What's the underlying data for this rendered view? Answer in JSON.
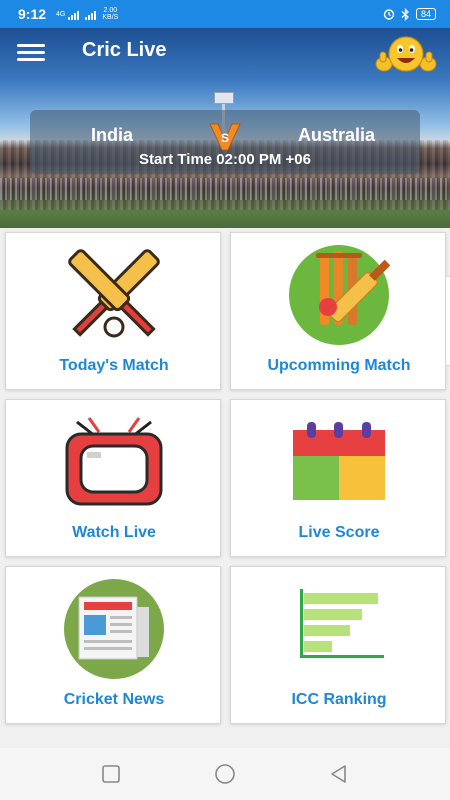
{
  "status_bar": {
    "time": "9:12",
    "network_type": "4G",
    "data_speed_value": "2.00",
    "data_speed_unit": "KB/S",
    "battery": "84"
  },
  "header": {
    "title": "Cric Live",
    "menu_icon": "hamburger-menu-icon",
    "emoji_icon": "thumbs-up-smiley-icon"
  },
  "match": {
    "team_a": "India",
    "team_b": "Australia",
    "vs_icon": "vs-icon",
    "start_time": "Start Time 02:00 PM +06"
  },
  "menu": [
    {
      "label": "Today's Match",
      "icon": "crossed-bats-ball-icon"
    },
    {
      "label": "Upcomming Match",
      "icon": "bat-stumps-ball-icon"
    },
    {
      "label": "Watch Live",
      "icon": "retro-tv-icon"
    },
    {
      "label": "Live Score",
      "icon": "calendar-icon"
    },
    {
      "label": "Cricket News",
      "icon": "newspaper-icon"
    },
    {
      "label": "ICC Ranking",
      "icon": "bar-chart-icon"
    }
  ],
  "colors": {
    "status_bar": "#1e88e5",
    "tile_label": "#1e88d6",
    "tile_background": "#ffffff",
    "page_background": "#f0f0f0"
  },
  "nav_bar": {
    "buttons": [
      "recent-apps-icon",
      "home-icon",
      "back-icon"
    ]
  }
}
